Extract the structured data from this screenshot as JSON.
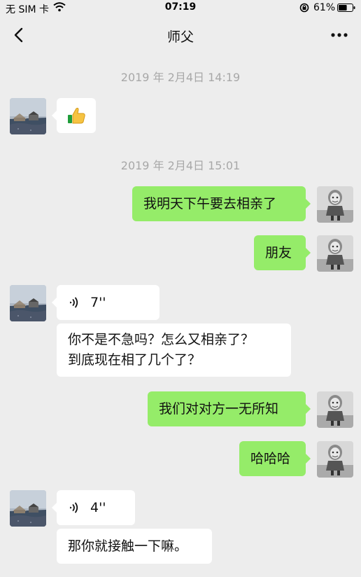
{
  "status_bar": {
    "carrier": "无 SIM 卡",
    "time": "07:19",
    "battery_percent": "61%",
    "battery_level": 0.61
  },
  "nav": {
    "title": "师父",
    "back_icon": "chevron-left-icon",
    "more_icon": "more-horizontal-icon"
  },
  "messages": [
    {
      "kind": "timestamp",
      "text": "2019 年 2月4日 14:19"
    },
    {
      "kind": "sticker",
      "sender": "them",
      "icon": "thumbs-up-icon"
    },
    {
      "kind": "timestamp",
      "text": "2019 年 2月4日 15:01"
    },
    {
      "kind": "text",
      "sender": "me",
      "text": "我明天下午要去相亲了"
    },
    {
      "kind": "text",
      "sender": "me",
      "text": "朋友"
    },
    {
      "kind": "voice",
      "sender": "them",
      "duration": "7''"
    },
    {
      "kind": "text",
      "sender": "them",
      "lines": [
        "你不是不急吗？怎么又相亲了？",
        "到底现在相了几个了？"
      ]
    },
    {
      "kind": "text",
      "sender": "me",
      "text": "我们对对方一无所知"
    },
    {
      "kind": "text",
      "sender": "me",
      "text": "哈哈哈"
    },
    {
      "kind": "voice",
      "sender": "them",
      "duration": "4''"
    },
    {
      "kind": "text",
      "sender": "them",
      "text": "那你就接触一下嘛。"
    }
  ],
  "colors": {
    "background": "#ededed",
    "outgoing_bubble": "#95ec69",
    "incoming_bubble": "#ffffff",
    "timestamp": "#a8a8a8"
  }
}
